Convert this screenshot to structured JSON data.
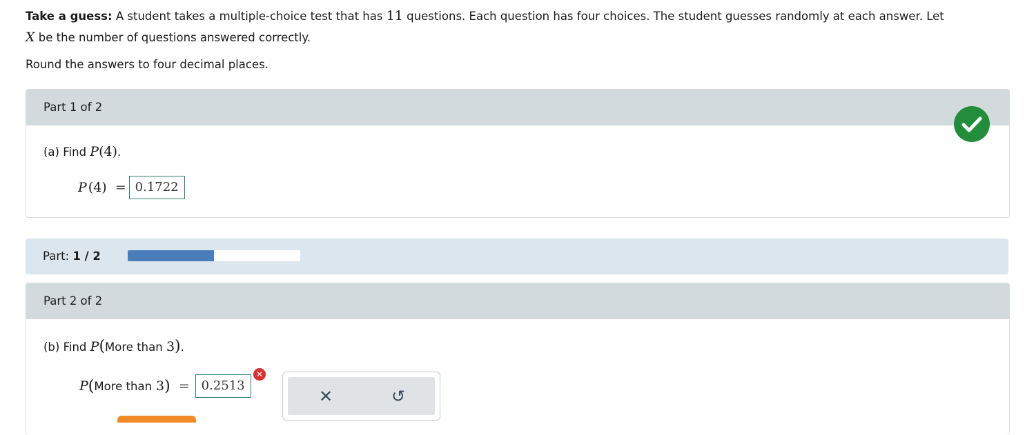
{
  "problem": {
    "lead": "Take a guess:",
    "text1": "A student takes a multiple-choice test that has",
    "n": "11",
    "text2": "questions. Each question has four choices. The student guesses randomly at each answer. Let",
    "var": "X",
    "text3": "be the number of questions answered correctly.",
    "round_note": "Round the answers to four decimal places."
  },
  "part1": {
    "header": "Part 1 of 2",
    "status_icon": "check-circle-icon",
    "question_prefix": "(a) Find",
    "question_math_p": "P",
    "question_math_arg": "(4)",
    "question_suffix": ".",
    "lhs_p": "P",
    "lhs_arg": "(4)",
    "equals": "=",
    "answer": "0.1722"
  },
  "progress": {
    "label": "Part:",
    "value": "1 / 2",
    "fraction": 0.5
  },
  "part2": {
    "header": "Part 2 of 2",
    "question_prefix": "(b) Find",
    "question_math_p": "P",
    "open_paren": "(",
    "question_text": "More than",
    "question_num": "3",
    "close_paren": ")",
    "question_suffix": ".",
    "lhs_p": "P",
    "lhs_text": "More than",
    "lhs_num": "3",
    "equals": "=",
    "answer": "0.2513",
    "error_icon": "x-error-icon",
    "clear_icon": "close-icon",
    "undo_icon": "undo-icon",
    "clear_glyph": "✕",
    "undo_glyph": "↺"
  },
  "colors": {
    "correct": "#228d3b",
    "error": "#d92f2f",
    "progress_fill": "#4a7ebb",
    "accent": "#f08b25"
  }
}
